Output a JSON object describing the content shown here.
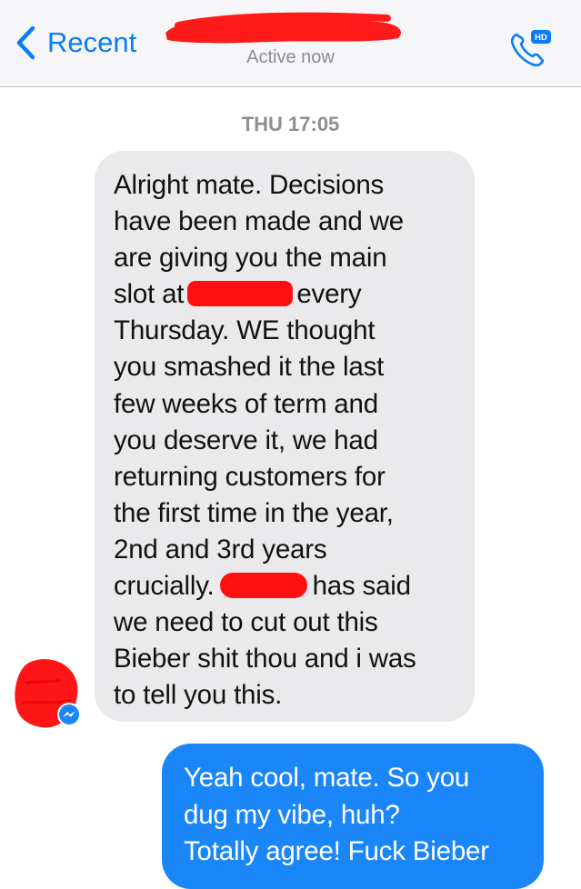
{
  "header": {
    "back_label": "Recent",
    "status": "Active now",
    "call_badge": "HD"
  },
  "conversation": {
    "timestamp": "THU 17:05",
    "incoming": {
      "lines": [
        "Alright mate. Decisions",
        "have been made and we",
        "are giving you the main",
        "slot at",
        "every",
        "Thursday. WE thought",
        "you smashed it the last",
        "few weeks of term and",
        "you deserve it, we had",
        "returning customers for",
        "the first time in the year,",
        "2nd and 3rd years",
        "crucially.",
        "has said",
        "we need to cut out this",
        "Bieber shit thou and i was",
        "to tell you this."
      ]
    },
    "outgoing": {
      "lines": [
        "Yeah cool, mate. So you",
        "dug my vibe, huh?",
        "Totally agree! Fuck Bieber"
      ]
    }
  },
  "colors": {
    "accent": "#0a7cf6",
    "incoming_bubble": "#eaeaec",
    "outgoing_bubble": "#1a86f8",
    "redaction": "#ff1010"
  },
  "icons": {
    "back": "chevron-left-icon",
    "call": "phone-icon",
    "badge": "messenger-icon"
  }
}
